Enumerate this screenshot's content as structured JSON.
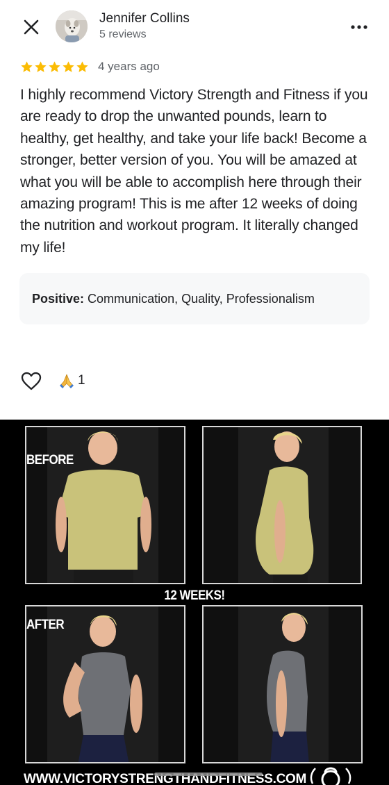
{
  "header": {
    "close_icon": "close-icon",
    "more_icon": "more-horizontal-icon",
    "reviewer_name": "Jennifer Collins",
    "reviewer_count": "5 reviews"
  },
  "rating": {
    "stars": 5,
    "max_stars": 5,
    "star_color": "#fbbc04",
    "date": "4 years ago"
  },
  "review": {
    "text": "I highly recommend Victory Strength and Fitness if you are ready to drop the unwanted pounds, learn to healthy, get healthy, and take your life back! Become a stronger, better version of you. You will be amazed at what you will be able to accomplish here through their amazing program! This is me after 12 weeks of doing the nutrition and workout program. It literally changed my life!"
  },
  "tags": {
    "label": "Positive:",
    "values": "Communication, Quality, Professionalism"
  },
  "actions": {
    "like_icon": "heart-outline-icon",
    "reaction_icon": "folded-hands-icon",
    "reaction_count": "1"
  },
  "photo": {
    "before_label": "BEFORE",
    "weeks_label": "12 WEEKS!",
    "after_label": "AFTER",
    "url_text": "WWW.VICTORYSTRENGTHANDFITNESS.COM"
  }
}
